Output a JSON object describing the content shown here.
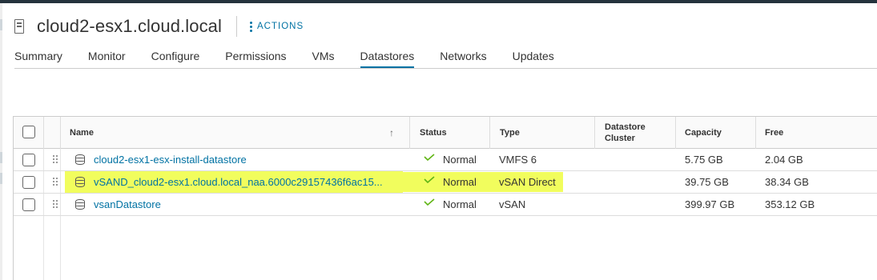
{
  "header": {
    "title": "cloud2-esx1.cloud.local",
    "actions_label": "ACTIONS"
  },
  "tabs": [
    {
      "label": "Summary",
      "active": false
    },
    {
      "label": "Monitor",
      "active": false
    },
    {
      "label": "Configure",
      "active": false
    },
    {
      "label": "Permissions",
      "active": false
    },
    {
      "label": "VMs",
      "active": false
    },
    {
      "label": "Datastores",
      "active": true
    },
    {
      "label": "Networks",
      "active": false
    },
    {
      "label": "Updates",
      "active": false
    }
  ],
  "table": {
    "columns": {
      "name": "Name",
      "status": "Status",
      "type": "Type",
      "cluster_line1": "Datastore",
      "cluster_line2": "Cluster",
      "capacity": "Capacity",
      "free": "Free"
    },
    "rows": [
      {
        "name": "cloud2-esx1-esx-install-datastore",
        "status": "Normal",
        "type": "VMFS 6",
        "cluster": "",
        "capacity": "5.75 GB",
        "free": "2.04 GB",
        "highlighted": false
      },
      {
        "name": "vSAND_cloud2-esx1.cloud.local_naa.6000c29157436f6ac15...",
        "status": "Normal",
        "type": "vSAN Direct",
        "cluster": "",
        "capacity": "39.75 GB",
        "free": "38.34 GB",
        "highlighted": true
      },
      {
        "name": "vsanDatastore",
        "status": "Normal",
        "type": "vSAN",
        "cluster": "",
        "capacity": "399.97 GB",
        "free": "353.12 GB",
        "highlighted": false
      }
    ]
  },
  "colors": {
    "accent": "#0072a3",
    "highlight": "#f1fd5d",
    "status_ok": "#60b515",
    "topbar": "#25333d"
  },
  "icons": {
    "host": "host-server-icon",
    "actions": "vertical-ellipsis-icon",
    "datastore": "datastore-cylinder-icon",
    "status": "checkmark-icon",
    "drag": "drag-handle-icon",
    "sort": "sort-ascending-arrow-icon"
  }
}
